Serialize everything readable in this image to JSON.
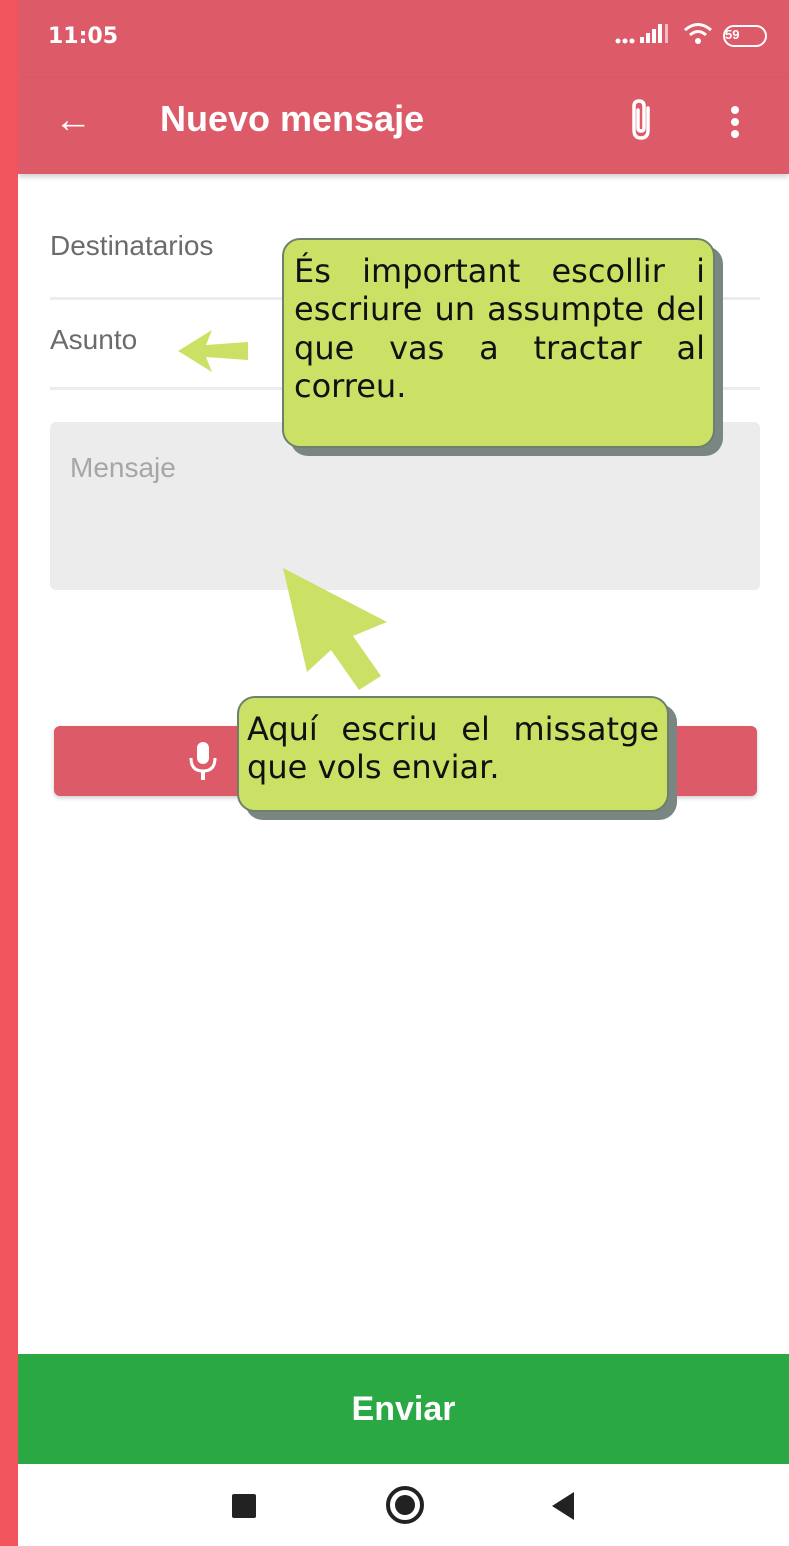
{
  "status": {
    "time": "11:05",
    "battery": "59",
    "signal": "signal-bars-icon",
    "wifi": "wifi-icon"
  },
  "appbar": {
    "title": "Nuevo mensaje",
    "back_icon": "arrow-back-icon",
    "attach_icon": "paperclip-icon",
    "more_icon": "more-vert-icon",
    "back_glyph": "←"
  },
  "form": {
    "recipients_placeholder": "Destinatarios",
    "subject_placeholder": "Asunto",
    "message_placeholder": "Mensaje"
  },
  "mic_icon": "microphone-icon",
  "annotations": {
    "subject_tip": "És important escollir i escriure un assumpte del que vas a tractar al correu.",
    "message_tip": "Aquí escriu el missatge que vols enviar."
  },
  "send_label": "Enviar",
  "nav": {
    "recents": "square-icon",
    "home": "circle-icon",
    "back": "triangle-back-icon"
  },
  "colors": {
    "appbar": "#dd5a68",
    "send": "#29a844",
    "tip": "#cbe166",
    "frame": "#f2545b"
  }
}
